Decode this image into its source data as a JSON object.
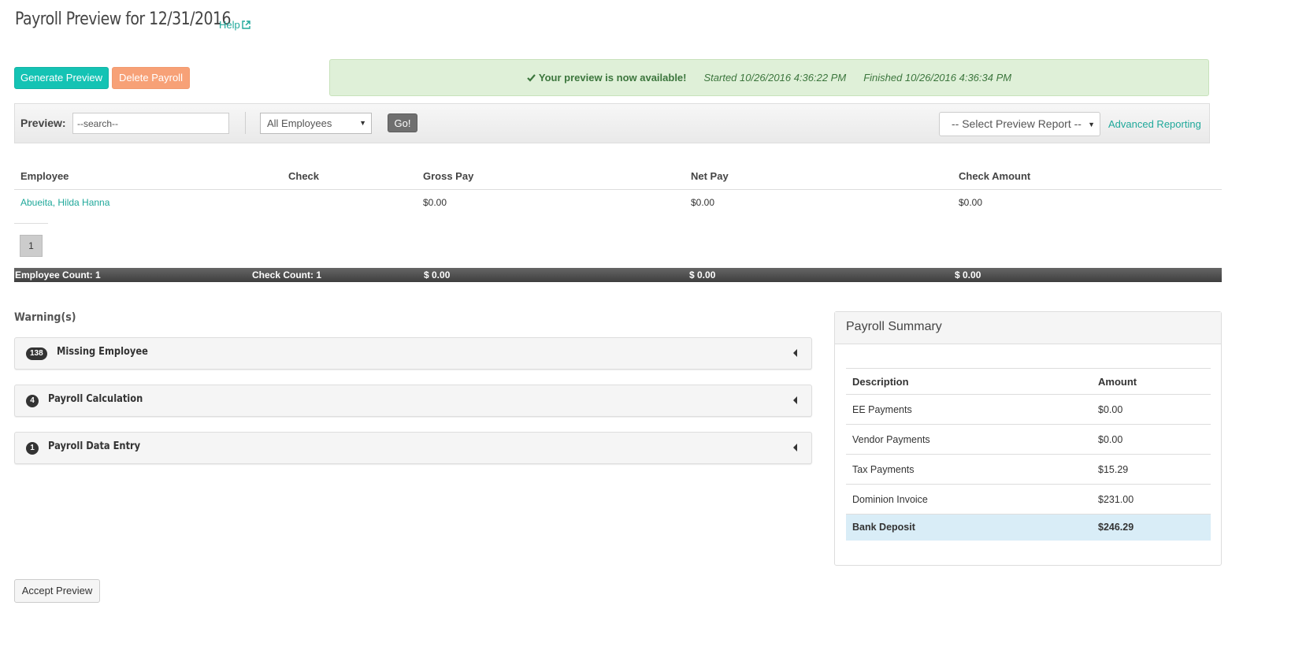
{
  "header": {
    "title": "Payroll Preview for 12/31/2016",
    "help_label": "Help"
  },
  "actions": {
    "generate_label": "Generate Preview",
    "delete_label": "Delete Payroll",
    "accept_label": "Accept Preview"
  },
  "alert": {
    "message": "Your preview is now available!",
    "started": "Started 10/26/2016 4:36:22 PM",
    "finished": "Finished 10/26/2016 4:36:34 PM"
  },
  "toolbar": {
    "preview_label": "Preview:",
    "search_value": "--search--",
    "employee_filter": "All Employees",
    "go_label": "Go!",
    "report_select": "-- Select Preview Report --",
    "advanced_label": "Advanced Reporting"
  },
  "employee_table": {
    "headers": [
      "Employee",
      "Check",
      "Gross Pay",
      "Net Pay",
      "Check Amount"
    ],
    "rows": [
      {
        "employee": "Abueita, Hilda Hanna",
        "check": "",
        "gross": "$0.00",
        "net": "$0.00",
        "amount": "$0.00"
      }
    ],
    "page": "1",
    "totals": {
      "employee_count": "Employee Count: 1",
      "check_count": "Check Count: 1",
      "gross": "$ 0.00",
      "net": "$ 0.00",
      "amount": "$ 0.00"
    }
  },
  "warnings": {
    "title": "Warning(s)",
    "items": [
      {
        "count": "138",
        "label": "Missing Employee"
      },
      {
        "count": "4",
        "label": "Payroll Calculation"
      },
      {
        "count": "1",
        "label": "Payroll Data Entry"
      }
    ]
  },
  "summary": {
    "title": "Payroll Summary",
    "col_description": "Description",
    "col_amount": "Amount",
    "rows": [
      {
        "description": "EE Payments",
        "amount": "$0.00"
      },
      {
        "description": "Vendor Payments",
        "amount": "$0.00"
      },
      {
        "description": "Tax Payments",
        "amount": "$15.29"
      },
      {
        "description": "Dominion Invoice",
        "amount": "$231.00"
      }
    ],
    "total": {
      "description": "Bank Deposit",
      "amount": "$246.29"
    }
  },
  "colors": {
    "accent": "#1fa89a",
    "generate": "#14c3b4",
    "delete": "#f7a177",
    "alert_bg": "#dff0d8",
    "total_row": "#d9edf7"
  }
}
